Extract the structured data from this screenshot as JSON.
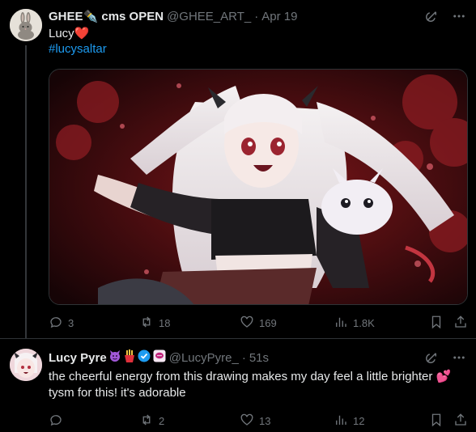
{
  "colors": {
    "background": "#000000",
    "text": "#e7e9ea",
    "muted": "#71767b",
    "link": "#1d9bf0",
    "verified": "#1d9bf0"
  },
  "tweets": [
    {
      "author_name": "GHEE✒️ cms OPEN",
      "handle": "@GHEE_ART_",
      "separator": "·",
      "time": "Apr 19",
      "text": "Lucy❤️",
      "hashtag": "#lucysaltar",
      "icons": [
        "grok-icon",
        "more-icon"
      ],
      "actions": {
        "replies": "3",
        "reposts": "18",
        "likes": "169",
        "views": "1.8K"
      }
    },
    {
      "author_name": "Lucy Pyre",
      "badges": [
        "devil-emoji",
        "fries-emoji",
        "verified-badge",
        "speech-badge"
      ],
      "handle": "@LucyPyre_",
      "separator": "·",
      "time": "51s",
      "text": "the cheerful energy from this drawing makes my day feel a little brighter 💕 tysm for this! it's adorable",
      "icons": [
        "grok-icon",
        "more-icon"
      ],
      "actions": {
        "replies": "",
        "reposts": "2",
        "likes": "13",
        "views": "12"
      }
    }
  ]
}
